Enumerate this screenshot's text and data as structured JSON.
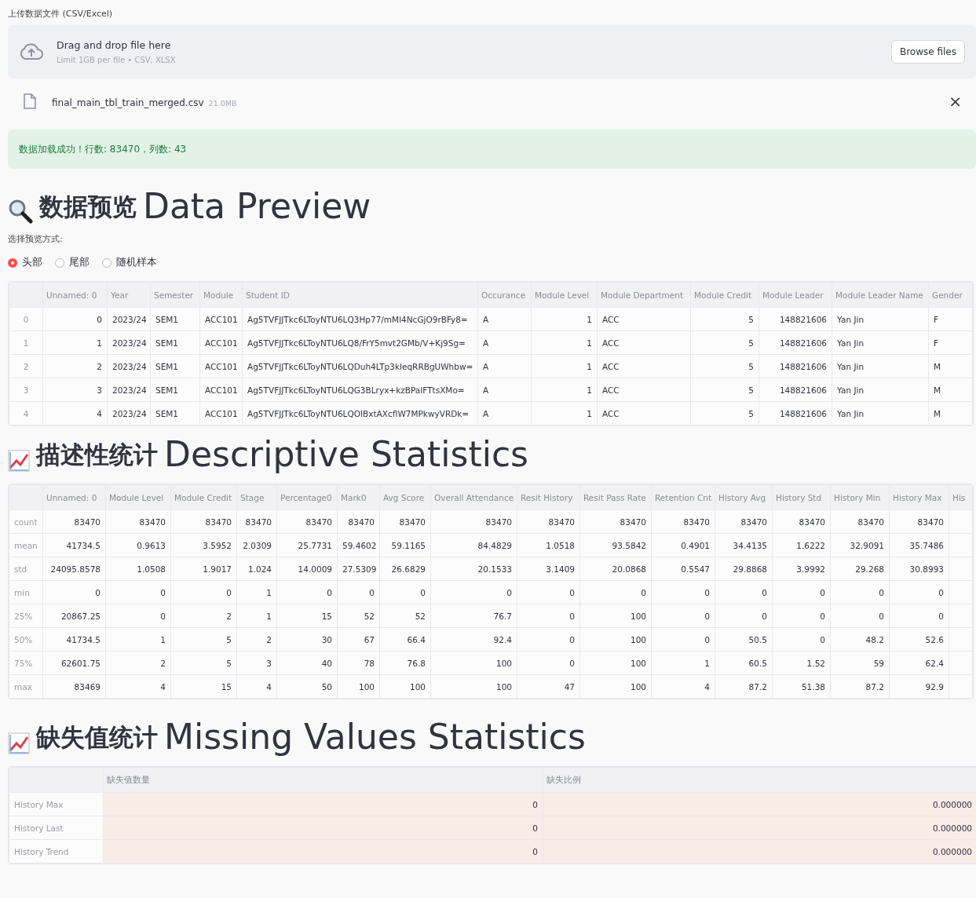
{
  "upload": {
    "label": "上传数据文件 (CSV/Excel)",
    "title": "Drag and drop file here",
    "hint": "Limit 1GB per file • CSV, XLSX",
    "button": "Browse files"
  },
  "file": {
    "name": "final_main_tbl_train_merged.csv",
    "size": "21.0MB",
    "remove": "×"
  },
  "success": "数据加载成功！行数: 83470，列数: 43",
  "preview": {
    "heading_zh": "数据预览",
    "heading_en": "Data Preview",
    "mode_label": "选择预览方式:",
    "options": [
      {
        "label": "头部",
        "selected": true
      },
      {
        "label": "尾部",
        "selected": false
      },
      {
        "label": "随机样本",
        "selected": false
      }
    ],
    "table": {
      "columns": [
        {
          "label": "Unnamed: 0",
          "kind": "number"
        },
        {
          "label": "Year",
          "kind": "text"
        },
        {
          "label": "Semester",
          "kind": "text"
        },
        {
          "label": "Module",
          "kind": "number"
        },
        {
          "label": "Student ID",
          "kind": "text"
        },
        {
          "label": "Occurance",
          "kind": "text"
        },
        {
          "label": "Module Level",
          "kind": "number"
        },
        {
          "label": "Module Department",
          "kind": "text"
        },
        {
          "label": "Module Credit",
          "kind": "number"
        },
        {
          "label": "Module Leader",
          "kind": "number"
        },
        {
          "label": "Module Leader Name",
          "kind": "text"
        },
        {
          "label": "Gender",
          "kind": "text"
        }
      ],
      "rows": [
        {
          "index": "0",
          "cells": [
            "0",
            "2023/24",
            "SEM1",
            "ACC101",
            "Ag5TVFJJTkc6LToyNTU6LQ3Hp77/mMl4NcGjO9rBFy8=",
            "A",
            "1",
            "ACC",
            "5",
            "148821606",
            "Yan Jin",
            "F"
          ]
        },
        {
          "index": "1",
          "cells": [
            "1",
            "2023/24",
            "SEM1",
            "ACC101",
            "Ag5TVFJJTkc6LToyNTU6LQ8/FrY5mvt2GMb/V+Kj9Sg=",
            "A",
            "1",
            "ACC",
            "5",
            "148821606",
            "Yan Jin",
            "F"
          ]
        },
        {
          "index": "2",
          "cells": [
            "2",
            "2023/24",
            "SEM1",
            "ACC101",
            "Ag5TVFJJTkc6LToyNTU6LQDuh4LTp3kleqRRBgUWhbw=",
            "A",
            "1",
            "ACC",
            "5",
            "148821606",
            "Yan Jin",
            "M"
          ]
        },
        {
          "index": "3",
          "cells": [
            "3",
            "2023/24",
            "SEM1",
            "ACC101",
            "Ag5TVFJJTkc6LToyNTU6LQG3BLryx+kzBPaIFTtsXMo=",
            "A",
            "1",
            "ACC",
            "5",
            "148821606",
            "Yan Jin",
            "M"
          ]
        },
        {
          "index": "4",
          "cells": [
            "4",
            "2023/24",
            "SEM1",
            "ACC101",
            "Ag5TVFJJTkc6LToyNTU6LQOIBxtAXcflW7MPkwyVRDk=",
            "A",
            "1",
            "ACC",
            "5",
            "148821606",
            "Yan Jin",
            "M"
          ]
        }
      ]
    }
  },
  "stats": {
    "heading_zh": "描述性统计",
    "heading_en": "Descriptive Statistics",
    "table": {
      "columns": [
        {
          "label": "Unnamed: 0",
          "kind": "number"
        },
        {
          "label": "Module Level",
          "kind": "number"
        },
        {
          "label": "Module Credit",
          "kind": "number"
        },
        {
          "label": "Stage",
          "kind": "number"
        },
        {
          "label": "Percentage0",
          "kind": "number"
        },
        {
          "label": "Mark0",
          "kind": "number"
        },
        {
          "label": "Avg Score",
          "kind": "number"
        },
        {
          "label": "Overall Attendance",
          "kind": "number"
        },
        {
          "label": "Resit History",
          "kind": "number"
        },
        {
          "label": "Resit Pass Rate",
          "kind": "number"
        },
        {
          "label": "Retention Cnt",
          "kind": "number"
        },
        {
          "label": "History Avg",
          "kind": "number"
        },
        {
          "label": "History Std",
          "kind": "number"
        },
        {
          "label": "History Min",
          "kind": "number"
        },
        {
          "label": "History Max",
          "kind": "number"
        },
        {
          "label": "His",
          "kind": "number"
        }
      ],
      "rows": [
        {
          "index": "count",
          "cells": [
            "83470",
            "83470",
            "83470",
            "83470",
            "83470",
            "83470",
            "83470",
            "83470",
            "83470",
            "83470",
            "83470",
            "83470",
            "83470",
            "83470",
            "83470"
          ]
        },
        {
          "index": "mean",
          "cells": [
            "41734.5",
            "0.9613",
            "3.5952",
            "2.0309",
            "25.7731",
            "59.4602",
            "59.1165",
            "84.4829",
            "1.0518",
            "93.5842",
            "0.4901",
            "34.4135",
            "1.6222",
            "32.9091",
            "35.7486"
          ]
        },
        {
          "index": "std",
          "cells": [
            "24095.8578",
            "1.0508",
            "1.9017",
            "1.024",
            "14.0009",
            "27.5309",
            "26.6829",
            "20.1533",
            "3.1409",
            "20.0868",
            "0.5547",
            "29.8868",
            "3.9992",
            "29.268",
            "30.8993"
          ]
        },
        {
          "index": "min",
          "cells": [
            "0",
            "0",
            "0",
            "1",
            "0",
            "0",
            "0",
            "0",
            "0",
            "0",
            "0",
            "0",
            "0",
            "0",
            "0"
          ]
        },
        {
          "index": "25%",
          "cells": [
            "20867.25",
            "0",
            "2",
            "1",
            "15",
            "52",
            "52",
            "76.7",
            "0",
            "100",
            "0",
            "0",
            "0",
            "0",
            "0"
          ]
        },
        {
          "index": "50%",
          "cells": [
            "41734.5",
            "1",
            "5",
            "2",
            "30",
            "67",
            "66.4",
            "92.4",
            "0",
            "100",
            "0",
            "50.5",
            "0",
            "48.2",
            "52.6"
          ]
        },
        {
          "index": "75%",
          "cells": [
            "62601.75",
            "2",
            "5",
            "3",
            "40",
            "78",
            "76.8",
            "100",
            "0",
            "100",
            "1",
            "60.5",
            "1.52",
            "59",
            "62.4"
          ]
        },
        {
          "index": "max",
          "cells": [
            "83469",
            "4",
            "15",
            "4",
            "50",
            "100",
            "100",
            "100",
            "47",
            "100",
            "4",
            "87.2",
            "51.38",
            "87.2",
            "92.9"
          ]
        }
      ]
    }
  },
  "missing": {
    "heading_zh": "缺失值统计",
    "heading_en": "Missing Values Statistics",
    "table": {
      "columns": [
        {
          "label": "缺失值数量",
          "kind": "number"
        },
        {
          "label": "缺失比例",
          "kind": "number"
        }
      ],
      "rows": [
        {
          "index": "History Max",
          "cells": [
            "0",
            "0.000000"
          ]
        },
        {
          "index": "History Last",
          "cells": [
            "0",
            "0.000000"
          ]
        },
        {
          "index": "History Trend",
          "cells": [
            "0",
            "0.000000"
          ]
        }
      ]
    }
  }
}
